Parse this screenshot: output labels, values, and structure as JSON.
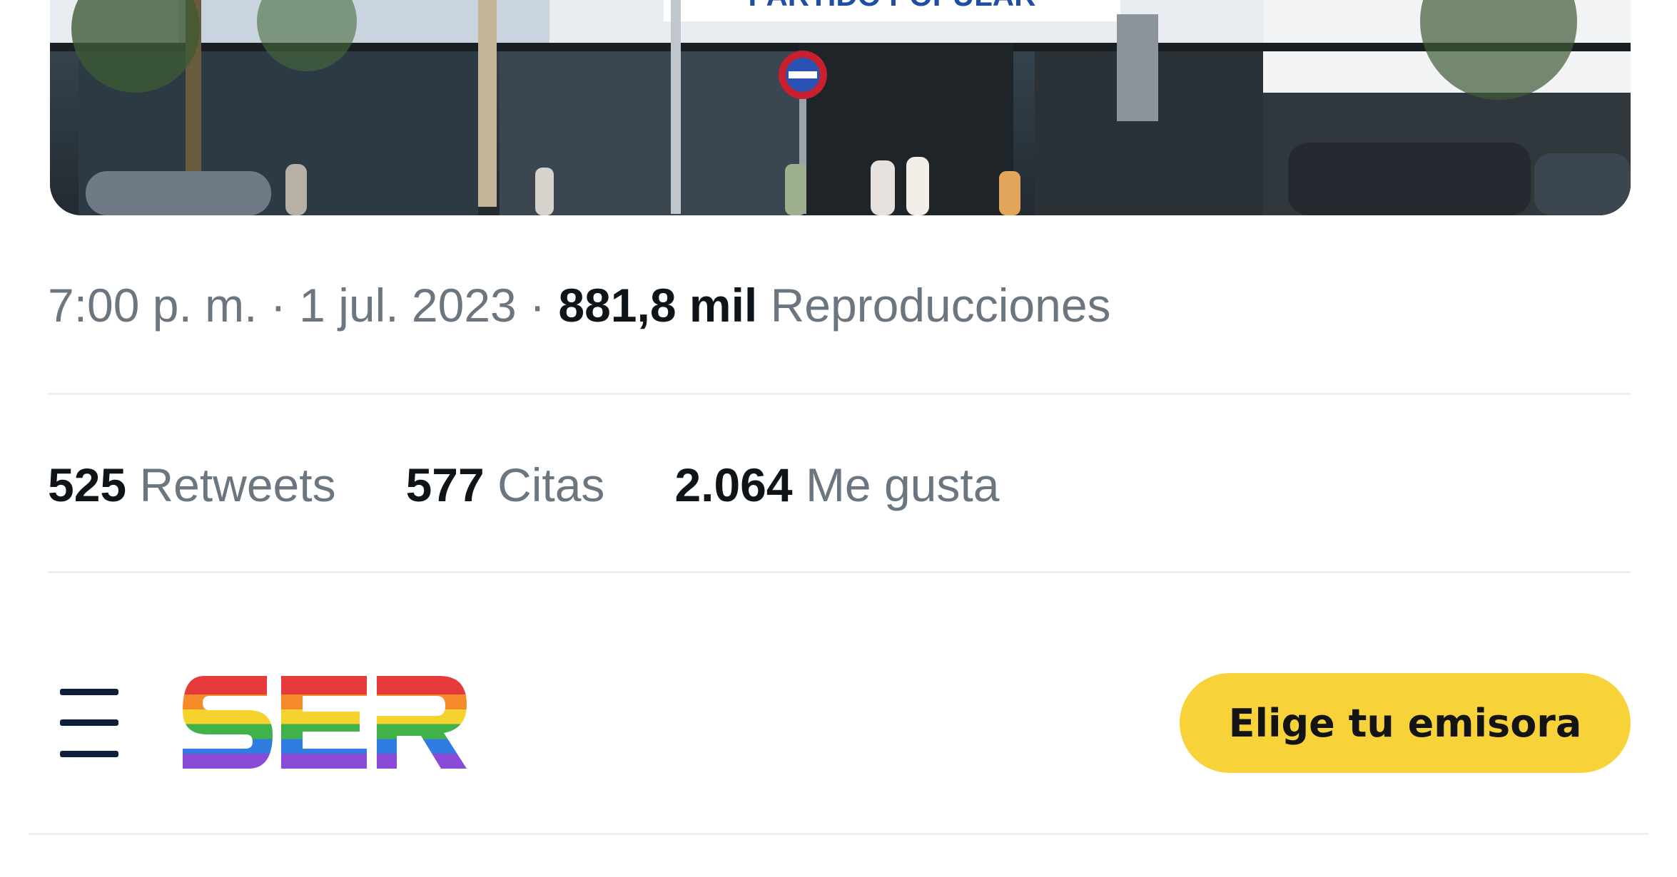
{
  "tweet": {
    "meta": {
      "time": "7:00 p. m.",
      "separator1": " · ",
      "date": "1 jul. 2023",
      "separator2": " · ",
      "views_count": "881,8 mil",
      "views_label": "Reproducciones"
    },
    "stats": [
      {
        "count": "525",
        "label": "Retweets"
      },
      {
        "count": "577",
        "label": "Citas"
      },
      {
        "count": "2.064",
        "label": "Me gusta"
      }
    ],
    "photo": {
      "sign_text": "PARTIDO POPULAR"
    }
  },
  "ser_header": {
    "menu_icon": "hamburger-icon",
    "logo_text": "SER",
    "cta_label": "Elige tu emisora",
    "colors": {
      "cta_background": "#f7d238",
      "logo_stripes": [
        "#e63b3b",
        "#f58a2b",
        "#f5d22e",
        "#3fb24a",
        "#2f7de1",
        "#8a4ad8"
      ]
    }
  },
  "colors": {
    "text_primary": "#0f1419",
    "text_secondary": "#6b7680",
    "divider": "#eceff1"
  }
}
